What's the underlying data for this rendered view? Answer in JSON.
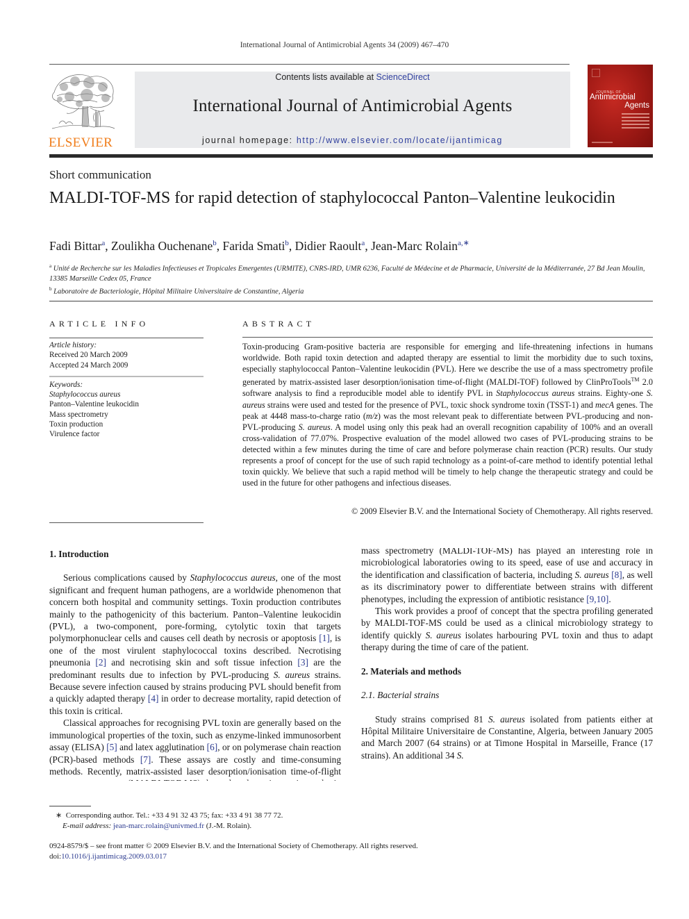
{
  "running_head": "International Journal of Antimicrobial Agents 34 (2009) 467–470",
  "masthead": {
    "publisher_name": "ELSEVIER",
    "contents_prefix": "Contents lists available at ",
    "contents_link": "ScienceDirect",
    "journal_title": "International Journal of Antimicrobial Agents",
    "homepage_prefix": "journal homepage: ",
    "homepage_url": "http://www.elsevier.com/locate/ijantimicag",
    "cover": {
      "small_label": "JOURNAL OF",
      "title_line1": "Antimicrobial",
      "title_line2": "Agents"
    }
  },
  "colors": {
    "link": "#2b3a8f",
    "publisher_orange": "#f07d1b",
    "masthead_bg": "#e9eaec",
    "cover_red": "#a31b16"
  },
  "article": {
    "type": "Short communication",
    "title": "MALDI-TOF-MS for rapid detection of staphylococcal Panton–Valentine leukocidin",
    "authors": [
      {
        "name": "Fadi Bittar",
        "sup": "a"
      },
      {
        "name": "Zoulikha Ouchenane",
        "sup": "b"
      },
      {
        "name": "Farida Smati",
        "sup": "b"
      },
      {
        "name": "Didier Raoult",
        "sup": "a"
      },
      {
        "name": "Jean-Marc Rolain",
        "sup": "a,∗"
      }
    ],
    "affiliations": [
      {
        "sup": "a",
        "text": "Unité de Recherche sur les Maladies Infectieuses et Tropicales Emergentes (URMITE), CNRS-IRD, UMR 6236, Faculté de Médecine et de Pharmacie, Université de la Méditerranée, 27 Bd Jean Moulin, 13385 Marseille Cedex 05, France"
      },
      {
        "sup": "b",
        "text": "Laboratoire de Bacteriologie, Hôpital Militaire Universitaire de Constantine, Algeria"
      }
    ]
  },
  "article_info": {
    "heading": "ARTICLE INFO",
    "history_label": "Article history:",
    "received": "Received 20 March 2009",
    "accepted": "Accepted 24 March 2009",
    "keywords_label": "Keywords:",
    "keywords": [
      "Staphylococcus aureus",
      "Panton–Valentine leukocidin",
      "Mass spectrometry",
      "Toxin production",
      "Virulence factor"
    ]
  },
  "abstract": {
    "heading": "ABSTRACT",
    "p1": "Toxin-producing Gram-positive bacteria are responsible for emerging and life-threatening infections in humans worldwide. Both rapid toxin detection and adapted therapy are essential to limit the morbidity due to such toxins, especially staphylococcal Panton–Valentine leukocidin (PVL). Here we describe the use of a mass spectrometry profile generated by matrix-assisted laser desorption/ionisation time-of-flight (MALDI-TOF) followed by ClinProTools",
    "tm": "TM",
    "p2": " 2.0 software analysis to find a reproducible model able to identify PVL in ",
    "it1": "Staphylococcus aureus",
    "p3": " strains. Eighty-one ",
    "it2": "S. aureus",
    "p4": " strains were used and tested for the presence of PVL, toxic shock syndrome toxin (TSST-1) and ",
    "it3": "mecA",
    "p5": " genes. The peak at 4448 mass-to-charge ratio (",
    "it4": "m/z",
    "p6": ") was the most relevant peak to differentiate between PVL-producing and non-PVL-producing ",
    "it5": "S. aureus",
    "p7": ". A model using only this peak had an overall recognition capability of 100% and an overall cross-validation of 77.07%. Prospective evaluation of the model allowed two cases of PVL-producing strains to be detected within a few minutes during the time of care and before polymerase chain reaction (PCR) results. Our study represents a proof of concept for the use of such rapid technology as a point-of-care method to identify potential lethal toxin quickly. We believe that such a rapid method will be timely to help change the therapeutic strategy and could be used in the future for other pathogens and infectious diseases.",
    "copyright": "© 2009 Elsevier B.V. and the International Society of Chemotherapy. All rights reserved."
  },
  "body": {
    "intro_heading": "1.  Introduction",
    "intro_p1": {
      "a": "Serious complications caused by ",
      "it_a": "Staphylococcus aureus",
      "b": ", one of the most significant and frequent human pathogens, are a worldwide phenomenon that concern both hospital and community settings. Toxin production contributes mainly to the pathogenicity of this bacterium. Panton–Valentine leukocidin (PVL), a two-component, pore-forming, cytolytic toxin that targets polymorphonuclear cells and causes cell death by necrosis or apoptosis ",
      "ref1": "[1]",
      "c": ", is one of the most virulent staphylococcal toxins described. Necrotising pneumonia ",
      "ref2": "[2]",
      "d": " and necrotising skin and soft tissue infection ",
      "ref3": "[3]",
      "e": " are the predominant results due to infection by PVL-producing ",
      "it_b": "S. aureus",
      "f": " strains. Because severe infection caused by strains producing PVL should benefit from a quickly adapted therapy ",
      "ref4": "[4]",
      "g": " in order to decrease mortality, rapid detection of this toxin is critical."
    },
    "intro_p2": {
      "a": "Classical approaches for recognising PVL toxin are generally based on the immunological properties of the toxin, such as enzyme-linked immunosorbent assay (ELISA) ",
      "ref5": "[5]",
      "b": " and latex agglutination ",
      "ref6": "[6]",
      "c": ", or on polymerase chain reaction (PCR)-based methods ",
      "ref7": "[7]",
      "d": ". These assays are costly and time-consuming methods. Recently, matrix-assisted laser desorption/ionisation time-of-flight mass spectrometry (MALDI-TOF-MS) has played an interesting role in microbiological laboratories owing to its speed, ease of use and accuracy in the identification and classification of bacteria, including ",
      "it_a": "S. aureus",
      "ref8": "[8]",
      "e": ", as well as its discriminatory power to differentiate between strains with different phenotypes, including the expression of antibiotic resistance ",
      "ref9": "[9,10]",
      "f": "."
    },
    "intro_p3": {
      "a": "This work provides a proof of concept that the spectra profiling generated by MALDI-TOF-MS could be used as a clinical microbiology strategy to identify quickly ",
      "it_a": "S. aureus",
      "b": " isolates harbouring PVL toxin and thus to adapt therapy during the time of care of the patient."
    },
    "methods_heading": "2.  Materials and methods",
    "strains_heading": "2.1.  Bacterial strains",
    "strains_p": {
      "a": "Study strains comprised 81 ",
      "it_a": "S. aureus",
      "b": " isolated from patients either at Hôpital Militaire Universitaire de Constantine, Algeria, between January 2005 and March 2007 (64 strains) or at Timone Hospital in Marseille, France (17 strains). An additional 34 ",
      "it_b": "S."
    }
  },
  "footnote": {
    "star": "∗",
    "corresponding": "Corresponding author. Tel.: +33 4 91 32 43 75; fax: +33 4 91 38 77 72.",
    "email_label": "E-mail address:",
    "email": "jean-marc.rolain@univmed.fr",
    "email_suffix": " (J.-M. Rolain)."
  },
  "front_matter": {
    "issn_line": "0924-8579/$ – see front matter © 2009 Elsevier B.V. and the International Society of Chemotherapy. All rights reserved.",
    "doi_prefix": "doi:",
    "doi": "10.1016/j.ijantimicag.2009.03.017"
  }
}
